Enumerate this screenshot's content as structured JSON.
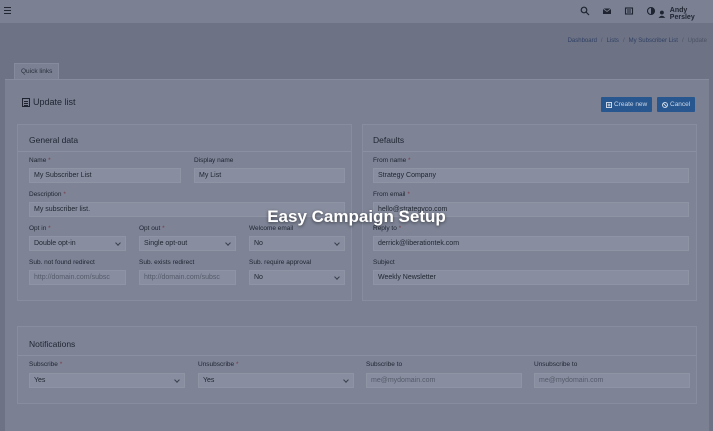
{
  "topbar": {
    "user_name": "Andy Persley",
    "icons": [
      "menu-icon",
      "search-icon",
      "mail-icon",
      "notes-icon",
      "contrast-icon",
      "user-icon"
    ]
  },
  "breadcrumb": {
    "items": [
      "Dashboard",
      "Lists",
      "My Subscriber List"
    ],
    "current": "Update",
    "separator": "/"
  },
  "quick_links": {
    "label": "Quick links"
  },
  "page": {
    "title": "Update list",
    "create_label": "Create new",
    "cancel_label": "Cancel"
  },
  "general": {
    "title": "General data",
    "name_label": "Name",
    "name_value": "My Subscriber List",
    "display_name_label": "Display name",
    "display_name_value": "My List",
    "description_label": "Description",
    "description_value": "My subscriber list.",
    "opt_in_label": "Opt in",
    "opt_in_value": "Double opt-in",
    "opt_out_label": "Opt out",
    "opt_out_value": "Single opt-out",
    "welcome_label": "Welcome email",
    "welcome_value": "No",
    "not_found_label": "Sub. not found redirect",
    "not_found_placeholder": "http://domain.com/subsc",
    "exists_label": "Sub. exists redirect",
    "exists_placeholder": "http://domain.com/subsc",
    "approval_label": "Sub. require approval",
    "approval_value": "No",
    "required_mark": "*"
  },
  "defaults": {
    "title": "Defaults",
    "from_name_label": "From name",
    "from_name_value": "Strategy Company",
    "from_email_label": "From email",
    "from_email_value": "hello@strategyco.com",
    "reply_label": "Reply to",
    "reply_value": "derrick@liberationtek.com",
    "subject_label": "Subject",
    "subject_value": "Weekly Newsletter"
  },
  "notifications": {
    "title": "Notifications",
    "subscribe_label": "Subscribe",
    "subscribe_value": "Yes",
    "unsubscribe_label": "Unsubscribe",
    "unsubscribe_value": "Yes",
    "subscribe_to_label": "Subscribe to",
    "subscribe_to_placeholder": "me@mydomain.com",
    "unsubscribe_to_label": "Unsubscribe to",
    "unsubscribe_to_placeholder": "me@mydomain.com"
  },
  "overlay": {
    "text": "Easy Campaign Setup"
  },
  "colors": {
    "background": "#6d7385",
    "panel": "#7b8193",
    "accent_button": "#28578f",
    "overlay_text": "#ffffff"
  }
}
